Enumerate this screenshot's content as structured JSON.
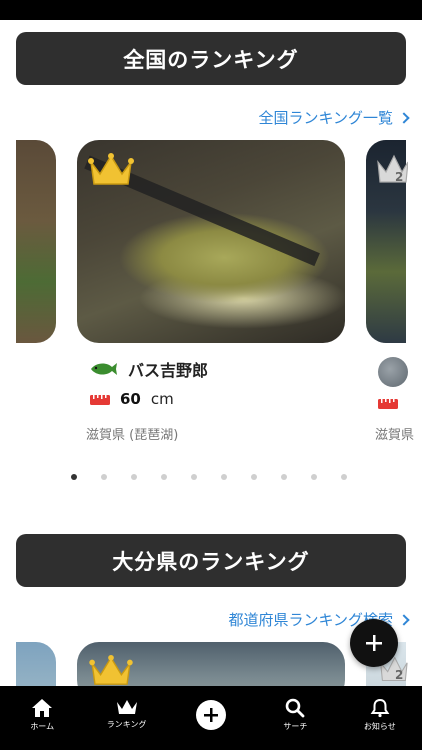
{
  "national": {
    "title": "全国のランキング",
    "link": "全国ランキング一覧",
    "entry": {
      "angler_name": "バス吉野郎",
      "size_value": "60",
      "size_unit": "cm",
      "location": "滋賀県 (琵琶湖)",
      "rank_right": "2",
      "location_right": "滋賀県"
    },
    "dots_total": 10,
    "dots_active": 1
  },
  "prefecture": {
    "title": "大分県のランキング",
    "link": "都道府県ランキング検索",
    "rank_right": "2"
  },
  "tabs": [
    {
      "label": "ホーム",
      "icon": "home-icon"
    },
    {
      "label": "ランキング",
      "icon": "crown-icon"
    },
    {
      "label": "",
      "icon": "add-icon"
    },
    {
      "label": "サーチ",
      "icon": "search-icon"
    },
    {
      "label": "お知らせ",
      "icon": "bell-icon"
    }
  ],
  "colors": {
    "accent_link": "#2f86d6",
    "header_bg": "#2f2f2f",
    "crown_gold": "#f1c232",
    "ruler_red": "#e53935"
  }
}
